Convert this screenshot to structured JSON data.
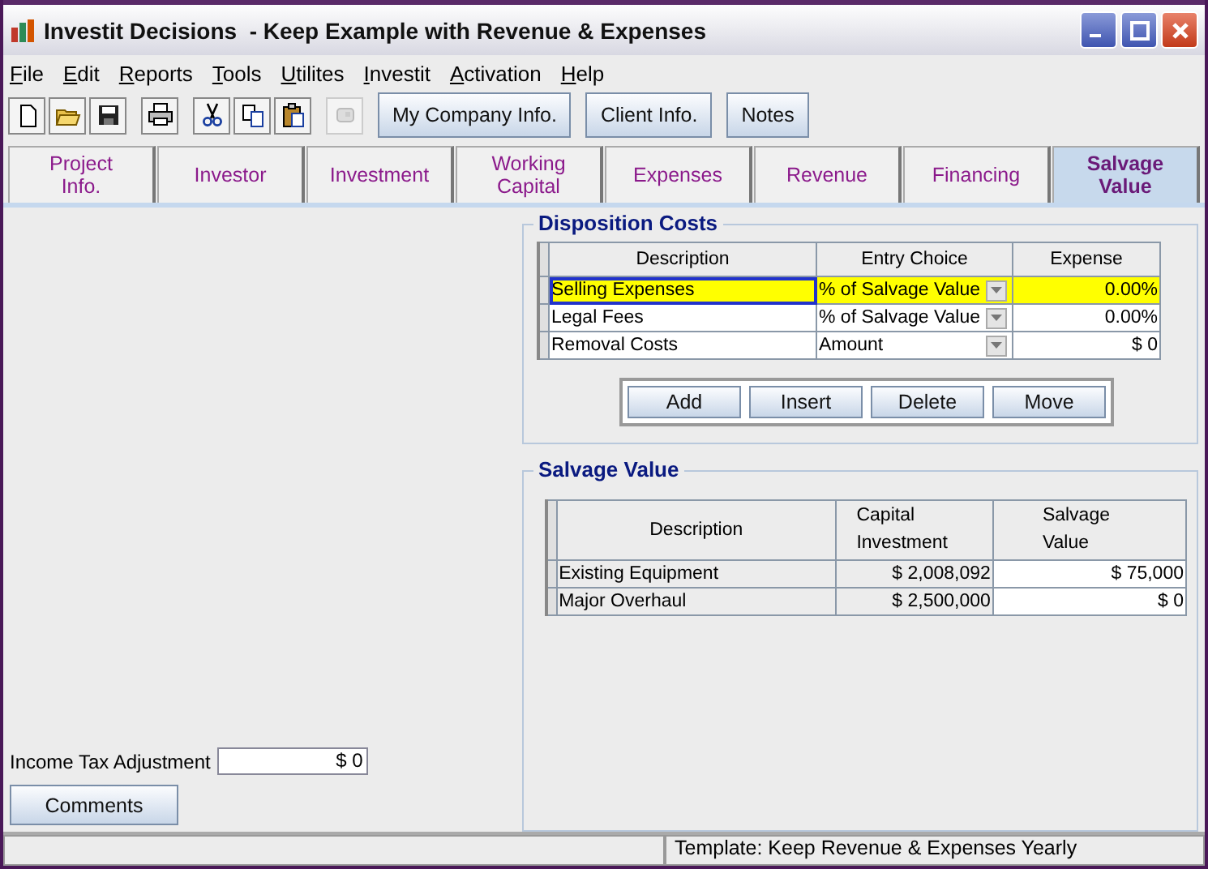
{
  "window": {
    "title": "Investit Decisions  - Keep Example with Revenue & Expenses"
  },
  "menu": [
    "File",
    "Edit",
    "Reports",
    "Tools",
    "Utilites",
    "Investit",
    "Activation",
    "Help"
  ],
  "toolbar": {
    "icons": [
      {
        "kind": "new",
        "disabled": false
      },
      {
        "kind": "open",
        "disabled": false
      },
      {
        "kind": "save",
        "disabled": false
      },
      {
        "kind": "print",
        "disabled": false
      },
      {
        "kind": "cut",
        "disabled": false
      },
      {
        "kind": "copy",
        "disabled": false
      },
      {
        "kind": "paste",
        "disabled": false
      },
      {
        "kind": "device",
        "disabled": true
      }
    ],
    "buttons": [
      "My Company Info.",
      "Client Info.",
      "Notes"
    ]
  },
  "tabs": [
    {
      "label": "Project\nInfo.",
      "selected": false
    },
    {
      "label": "Investor",
      "selected": false
    },
    {
      "label": "Investment",
      "selected": false
    },
    {
      "label": "Working\nCapital",
      "selected": false
    },
    {
      "label": "Expenses",
      "selected": false
    },
    {
      "label": "Revenue",
      "selected": false
    },
    {
      "label": "Financing",
      "selected": false
    },
    {
      "label": "Salvage\nValue",
      "selected": true
    }
  ],
  "disposition_costs": {
    "title": "Disposition Costs",
    "columns": [
      "Description",
      "Entry Choice",
      "Expense"
    ],
    "rows": [
      {
        "description": "Selling Expenses",
        "entry_choice": "% of Salvage Value",
        "expense": "0.00%",
        "selected": true
      },
      {
        "description": "Legal Fees",
        "entry_choice": "% of Salvage Value",
        "expense": "0.00%",
        "selected": false
      },
      {
        "description": "Removal Costs",
        "entry_choice": "Amount",
        "expense": "$ 0",
        "selected": false
      }
    ],
    "buttons": [
      "Add",
      "Insert",
      "Delete",
      "Move"
    ]
  },
  "salvage_value": {
    "title": "Salvage Value",
    "columns": [
      "Description",
      "Capital\nInvestment",
      "Salvage\nValue"
    ],
    "rows": [
      {
        "description": "Existing Equipment",
        "capital_investment": "$ 2,008,092",
        "salvage_value": "$ 75,000"
      },
      {
        "description": "Major Overhaul",
        "capital_investment": "$ 2,500,000",
        "salvage_value": "$ 0"
      }
    ]
  },
  "income_tax_adjustment": {
    "label": "Income Tax Adjustment",
    "value": "$ 0"
  },
  "comments_button": "Comments",
  "status_bar": {
    "template": "Template: Keep Revenue & Expenses Yearly"
  }
}
